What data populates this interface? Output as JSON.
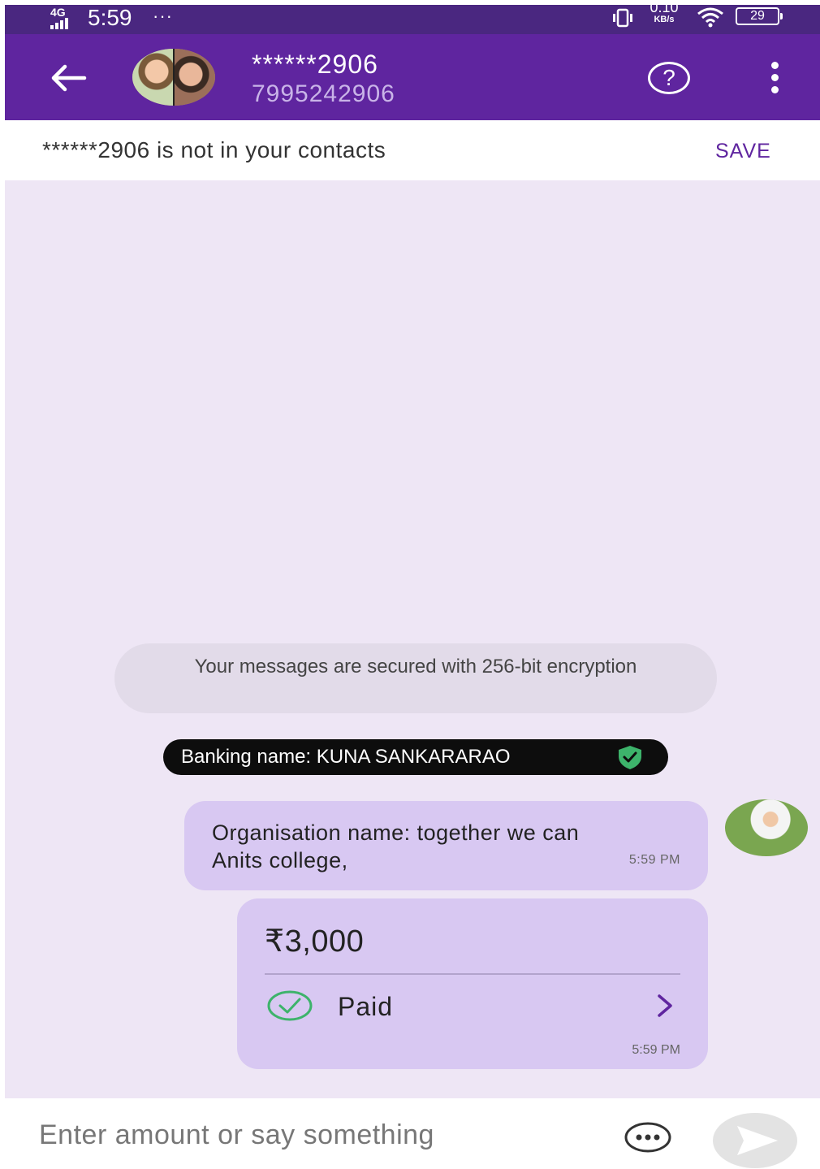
{
  "status_bar": {
    "network": "4G",
    "time": "5:59",
    "dots": "···",
    "speed_value": "0.10",
    "speed_unit": "KB/s",
    "battery": "29"
  },
  "header": {
    "contact_name": "******2906",
    "contact_phone": "7995242906",
    "help_symbol": "?"
  },
  "banner": {
    "text": "******2906 is not in your contacts",
    "save_label": "SAVE"
  },
  "chat": {
    "security_note": "Your messages are secured with 256-bit encryption",
    "banking_name": "Banking name: KUNA  SANKARARAO",
    "messages": [
      {
        "text_line1": "Organisation name: together we can",
        "text_line2": "Anits college,",
        "time": "5:59 PM"
      }
    ],
    "payment": {
      "amount": "₹3,000",
      "status": "Paid",
      "time": "5:59 PM"
    }
  },
  "input": {
    "placeholder": "Enter amount or say something"
  },
  "colors": {
    "brand_purple": "#5f259f",
    "status_bar": "#4a2780",
    "chat_bg": "#eee6f5",
    "bubble": "#d8c8f2",
    "success_green": "#3db36b"
  },
  "icons": {
    "back": "arrow-left-icon",
    "help": "help-circle-icon",
    "more": "more-vertical-icon",
    "verified": "verified-shield-icon",
    "paid": "check-circle-icon",
    "chevron": "chevron-right-icon",
    "options": "chat-options-icon",
    "send": "send-icon"
  }
}
